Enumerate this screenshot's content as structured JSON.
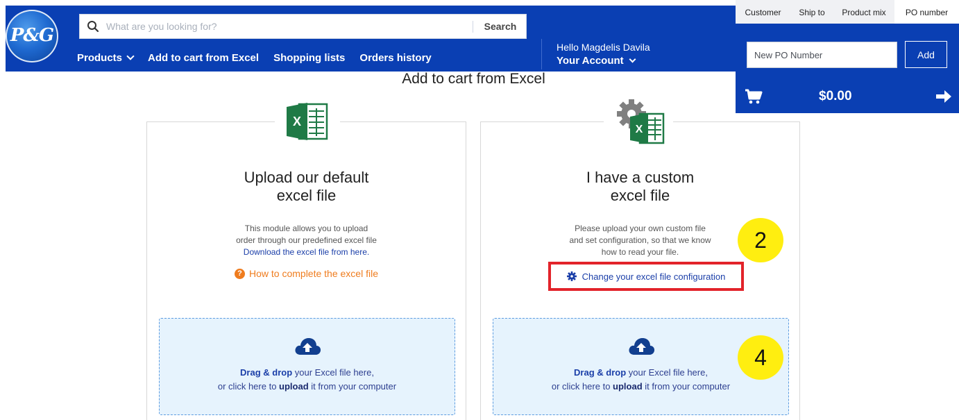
{
  "brand": {
    "logo_text": "P&G",
    "primary_color": "#0a3fb3"
  },
  "search": {
    "placeholder": "What are you looking for?",
    "button_label": "Search"
  },
  "nav": {
    "products": "Products",
    "add_to_cart_excel": "Add to cart from Excel",
    "shopping_lists": "Shopping lists",
    "orders_history": "Orders history"
  },
  "account": {
    "greeting": "Hello Magdelis Davila",
    "label": "Your Account"
  },
  "right_panel": {
    "tabs": [
      "Customer",
      "Ship to",
      "Product mix",
      "PO number"
    ],
    "active_tab": "PO number",
    "po_placeholder": "New PO Number",
    "po_add_label": "Add",
    "cart_total": "$0.00"
  },
  "page": {
    "title": "Add to cart from Excel"
  },
  "default_card": {
    "title_line1": "Upload our default",
    "title_line2": "excel file",
    "desc_line1": "This module allows you to upload",
    "desc_line2": "order through our predefined excel file",
    "download_link": "Download the excel file from here.",
    "help_link": "How to complete the excel file",
    "drop_bold1": "Drag & drop",
    "drop_text1": " your Excel file here,",
    "drop_text2a": "or click here to ",
    "drop_bold2": "upload",
    "drop_text2b": " it from your computer"
  },
  "custom_card": {
    "title_line1": "I have a custom",
    "title_line2": "excel file",
    "desc_line1": "Please upload your own custom file",
    "desc_line2": "and set configuration, so that we know",
    "desc_line3": "how to read your file.",
    "config_link": "Change your excel file configuration",
    "drop_bold1": "Drag & drop",
    "drop_text1": " your Excel file here,",
    "drop_text2a": "or click here to ",
    "drop_bold2": "upload",
    "drop_text2b": " it from your computer"
  },
  "annotations": {
    "step_a": "2",
    "step_b": "4",
    "highlight_color": "#e2232a",
    "bubble_color": "#ffee10"
  }
}
